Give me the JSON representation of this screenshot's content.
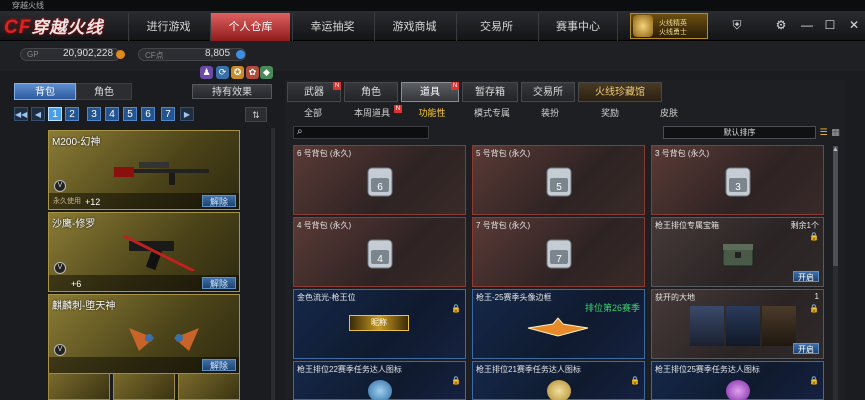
{
  "window": {
    "title": "穿越火线"
  },
  "nav": {
    "logo": "穿越火线",
    "tabs": [
      "进行游戏",
      "个人仓库",
      "幸运抽奖",
      "游戏商城",
      "交易所",
      "赛事中心"
    ],
    "active_tab": "个人仓库",
    "badge_line1": "火线精英",
    "badge_line2": "火线勇士"
  },
  "stats": {
    "gp_label": "GP",
    "gp_value": "20,902,228",
    "cf_label": "CF点",
    "cf_value": "8,805"
  },
  "left": {
    "tabs": [
      "背包",
      "角色"
    ],
    "active_tab": "背包",
    "effects_button": "持有效果",
    "pages": [
      "1",
      "2",
      "3",
      "4",
      "5",
      "6",
      "7"
    ],
    "active_page": "1",
    "items": [
      {
        "name": "M200-幻神",
        "level": "+12",
        "remove": "解除",
        "tag": "永久使用"
      },
      {
        "name": "沙鹰-修罗",
        "level": "+6",
        "remove": "解除",
        "tag": ""
      },
      {
        "name": "麒麟刺-堕天神",
        "level": "",
        "remove": "解除",
        "tag": ""
      }
    ]
  },
  "right": {
    "tabs": [
      "武器",
      "角色",
      "道具",
      "暂存箱",
      "交易所",
      "火线珍藏馆"
    ],
    "active_tab": "道具",
    "subtabs": [
      "全部",
      "本周道具",
      "功能性",
      "模式专属",
      "装扮",
      "奖励",
      "皮肤"
    ],
    "active_subtab": "功能性",
    "sort_label": "默认排序",
    "cards": [
      {
        "name": "6 号背包 (永久)",
        "num": "6"
      },
      {
        "name": "5 号背包 (永久)",
        "num": "5"
      },
      {
        "name": "3 号背包 (永久)",
        "num": "3"
      },
      {
        "name": "4 号背包 (永久)",
        "num": "4"
      },
      {
        "name": "7 号背包 (永久)",
        "num": "7"
      },
      {
        "name": "枪王排位专属宝箱",
        "right": "剩余1个",
        "button": "开启"
      },
      {
        "name": "金色流光-枪王位",
        "label": "昵称"
      },
      {
        "name": "枪王-25赛季头像边框",
        "green": "排位第26赛季"
      },
      {
        "name": "获开的大地",
        "right": "1",
        "button": "开启"
      },
      {
        "name": "枪王排位22赛季任务达人图标"
      },
      {
        "name": "枪王排位21赛季任务达人图标"
      },
      {
        "name": "枪王排位25赛季任务达人图标"
      }
    ]
  },
  "colors": {
    "accent_red": "#c8302a",
    "accent_blue": "#2c5a9e",
    "gold": "#ffcc33"
  }
}
